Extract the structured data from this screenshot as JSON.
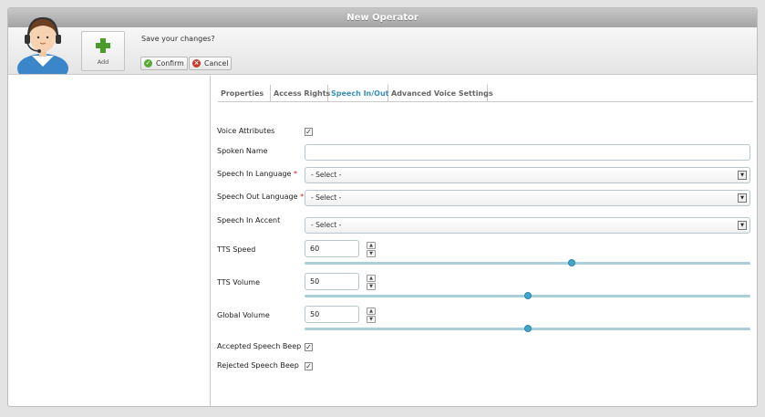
{
  "window": {
    "title": "New Operator"
  },
  "header": {
    "add_label": "Add",
    "prompt": "Save your changes?",
    "confirm_label": "Confirm",
    "cancel_label": "Cancel"
  },
  "tabs": [
    {
      "label": "Properties",
      "active": false
    },
    {
      "label": "Access Rights",
      "active": false
    },
    {
      "label": "Speech In/Out",
      "active": true
    },
    {
      "label": "Advanced Voice Settings",
      "active": false
    }
  ],
  "form": {
    "voice_attributes": {
      "label": "Voice Attributes",
      "checked": true
    },
    "spoken_name": {
      "label": "Spoken Name",
      "value": ""
    },
    "speech_in_language": {
      "label": "Speech In Language",
      "required_mark": "*",
      "value": "- Select -"
    },
    "speech_out_language": {
      "label": "Speech Out Language",
      "required_mark": "*",
      "value": "- Select -"
    },
    "speech_in_accent": {
      "label": "Speech In Accent",
      "value": "- Select -"
    },
    "tts_speed": {
      "label": "TTS Speed",
      "value": "60",
      "slider_fraction": 0.6
    },
    "tts_volume": {
      "label": "TTS Volume",
      "value": "50",
      "slider_fraction": 0.5
    },
    "global_volume": {
      "label": "Global Volume",
      "value": "50",
      "slider_fraction": 0.5
    },
    "accepted_speech_beep": {
      "label": "Accepted Speech Beep",
      "checked": true
    },
    "rejected_speech_beep": {
      "label": "Rejected Speech Beep",
      "checked": true
    }
  },
  "icons": {
    "avatar": "operator-headset-avatar",
    "add": "plus-icon",
    "confirm": "check-circle-icon",
    "cancel": "x-circle-icon",
    "dropdown": "chevron-down-icon",
    "spin_up": "chevron-up-icon",
    "spin_down": "chevron-down-icon"
  },
  "colors": {
    "accent": "#3a8fb7",
    "confirm": "#58a935",
    "cancel": "#c73a2c",
    "slider_track": "#a9cfd9",
    "slider_thumb": "#3fa6cf",
    "required": "#c62121"
  }
}
